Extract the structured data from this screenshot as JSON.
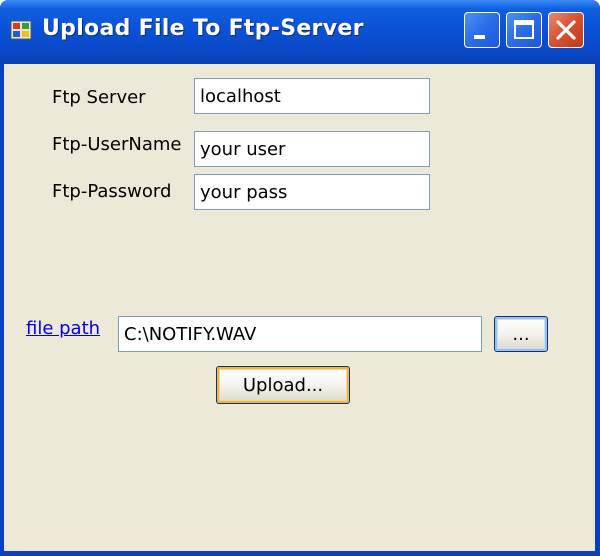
{
  "window": {
    "title": "Upload File To Ftp-Server",
    "icon": "app-window-icon",
    "controls": [
      "minimize-icon",
      "maximize-icon",
      "close-icon"
    ]
  },
  "form": {
    "server_label": "Ftp Server",
    "server_value": "localhost",
    "username_label": "Ftp-UserName",
    "username_value": "your user",
    "password_label": "Ftp-Password",
    "password_value": "your pass",
    "filepath_link": "file path",
    "filepath_value": "C:\\NOTIFY.WAV",
    "browse_label": "...",
    "upload_label": "Upload..."
  },
  "colors": {
    "titlebar": "#0b52d6",
    "client_background": "#ece9d8",
    "close_button": "#d6502f",
    "link": "#0000ee"
  }
}
